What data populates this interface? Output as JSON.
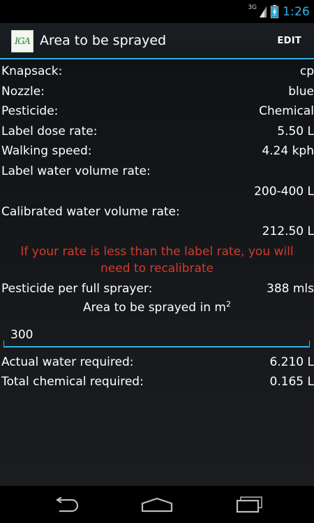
{
  "status_bar": {
    "network": "3G",
    "time": "1:26"
  },
  "action_bar": {
    "logo_text": "IGA",
    "title": "Area to be sprayed",
    "edit_label": "EDIT"
  },
  "rows": [
    {
      "label": "Knapsack:",
      "value": "cp"
    },
    {
      "label": "Nozzle:",
      "value": "blue"
    },
    {
      "label": "Pesticide:",
      "value": "Chemical"
    },
    {
      "label": "Label dose rate:",
      "value": "5.50 L"
    },
    {
      "label": "Walking speed:",
      "value": "4.24 kph"
    }
  ],
  "label_water": {
    "label": "Label water volume rate:",
    "value": "200-400 L"
  },
  "calibrated_water": {
    "label": "Calibrated water volume rate:",
    "value": "212.50 L"
  },
  "warning": "If your rate is less than the label rate, you will need to recalibrate",
  "pesticide_per_sprayer": {
    "label": "Pesticide per full sprayer:",
    "value": "388 mls"
  },
  "area_section": {
    "label": "Area to be sprayed in m",
    "superscript": "2",
    "input_value": "300"
  },
  "results": [
    {
      "label": "Actual water required:",
      "value": "6.210 L"
    },
    {
      "label": "Total chemical required:",
      "value": "0.165 L"
    }
  ],
  "colors": {
    "accent": "#33b5e5",
    "warning": "#d33b2c"
  }
}
